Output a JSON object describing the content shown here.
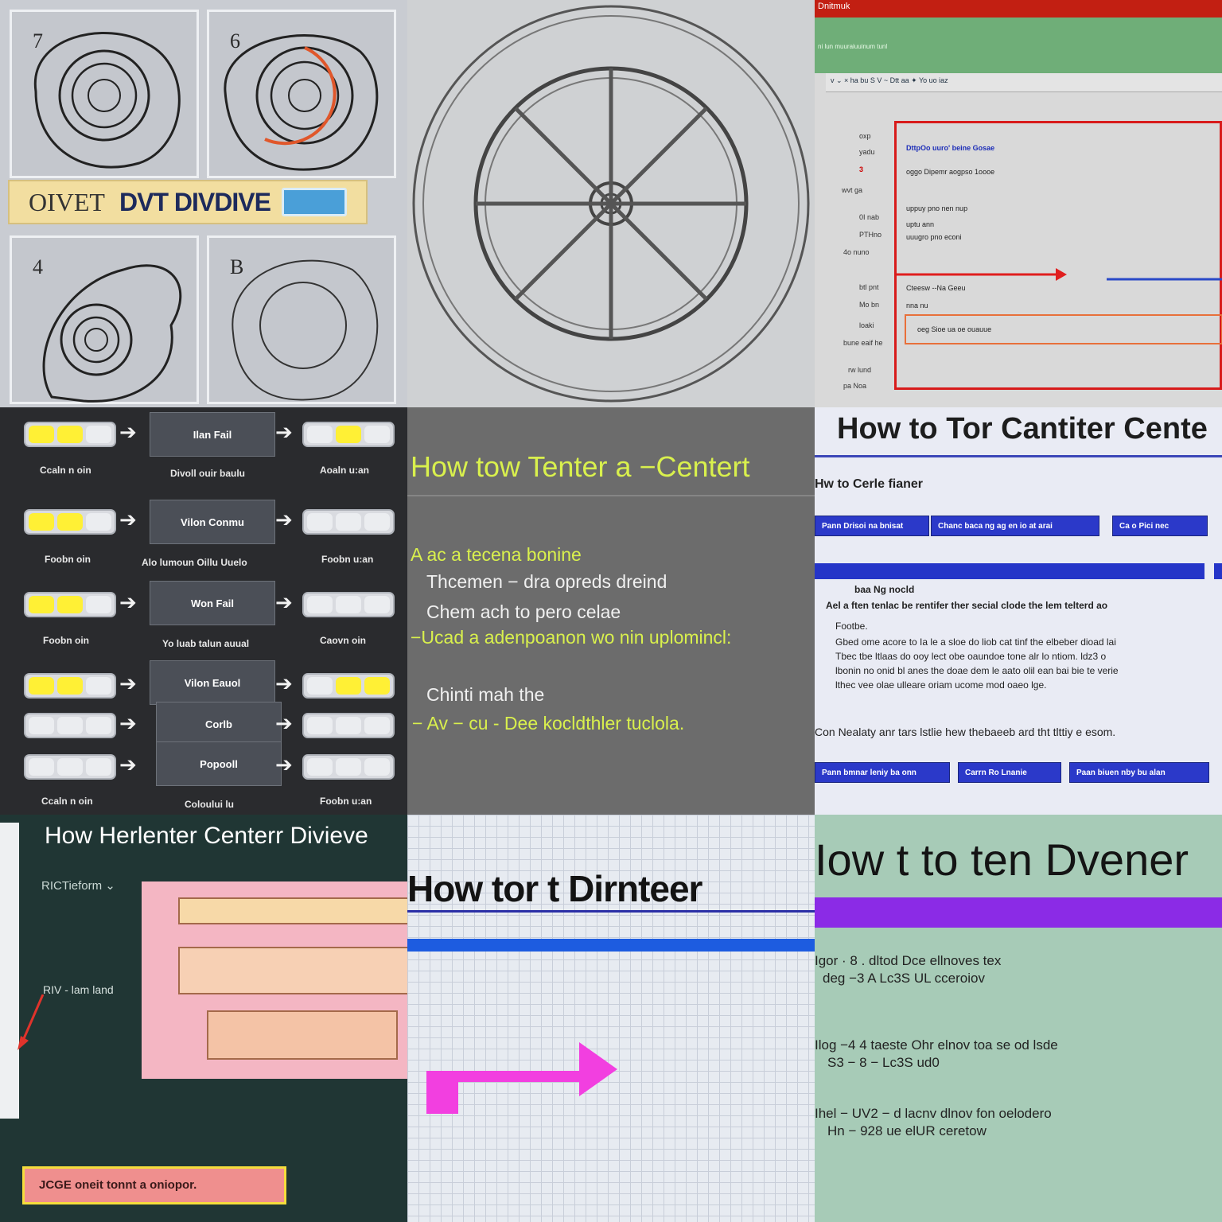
{
  "tile1": {
    "nums": [
      "7",
      "6",
      "4",
      "B"
    ],
    "banner_left": "OIVET",
    "banner_main": "DVT DIVDIVE",
    "colors": {
      "banner": "#f2dea0",
      "accent_ring": "#e0572b"
    }
  },
  "tile2": {
    "subject": "wheel-sketch"
  },
  "tile3": {
    "title": "Dnitmuk",
    "green_text": "ni lun muuraiuuinum tunl",
    "toolbar": "v  ⌄ ×  ha bu   S  V  ~  Dtt aa  ✦  Yo uo iaz",
    "side_labels": [
      "oxp",
      "yadu",
      "3",
      "wvt ga",
      "0I nab",
      "PTHno",
      "4o nuno",
      "btl pnt",
      "Mo bn",
      "loaki",
      "bune eaif he",
      "rw lund",
      "pa Noa"
    ],
    "rows": [
      "DttpOo  uuro' beine  Gosae",
      "oggo Dipemr  aogpso 1oooe",
      "uppuy pno nen nup",
      "uptu ann",
      "uuugro pno econi",
      "Cteesw  --Na     Geeu",
      "nna nu",
      "oeg Sioe ua oe ouauue"
    ],
    "colors": {
      "frame": "#d81b1b",
      "ribbon": "#6fae78"
    }
  },
  "tile4": {
    "rows": [
      {
        "left_label": "Ccaln n oin",
        "box": "Ilan Fail",
        "below": "Divoll ouir baulu",
        "right_label": "Aoaln u:an"
      },
      {
        "left_label": "Foobn oin",
        "box": "Vilon Conmu",
        "below": "Alo lumoun Oillu Uuelo",
        "right_label": "Foobn u:an"
      },
      {
        "left_label": "Foobn oin",
        "box": "Won Fail",
        "below": "Yo luab talun auual",
        "right_label": "Caovn oin"
      },
      {
        "left_label": "",
        "box": "Vilon Eauol",
        "below": "",
        "right_label": ""
      },
      {
        "left_label": "",
        "box": "Corlb",
        "below": "",
        "right_label": ""
      },
      {
        "left_label": "Ccaln n oin",
        "box": "Popooll",
        "below": "Coloului lu",
        "right_label": "Foobn u:an"
      }
    ]
  },
  "tile5": {
    "title": "How tow Tenter a −Centert",
    "lines": [
      "A ac a tecena bonine",
      "Thcemen − dra opreds dreind",
      "Chem ach to pero celae",
      "−Ucad a adenpoanon wo nin uplomincl:",
      "Chinti mah the",
      "− Av − cu - Dee kocldthler tuclola."
    ],
    "colors": {
      "accent": "#d9f04d"
    }
  },
  "tile6": {
    "title": "How to Tor Cantiter Cente",
    "subtitle": "Hw to Cerle fianer",
    "buttons_top": [
      "Pann Drisoi na bnisat",
      "Chanc baca ng ag en io at arai",
      "Ca   o  Pici  nec"
    ],
    "section_label": "baa Ng nocld",
    "para_lines": [
      "Ael a ften tenlac be rentifer ther secial clode the lem telterd ao",
      "Footbe.",
      "Gbed ome acore to Ia le a sloe do liob cat tinf the elbeber dioad lai",
      "Tbec tbe ltlaas do ooy lect obe oaundoe tone alr lo ntiom. ldz3 o",
      "lbonin no onid bl anes the doae dem le aato olil ean bai bie te verie",
      "lthec vee olae ulleare oriam ucome mod oaeo lge.",
      "Con Nealaty anr tars lstlie hew thebaeeb ard tht tlttiy e esom."
    ],
    "buttons_bottom": [
      "Pann bmnar leniy ba onn",
      "Carrn Ro Lnanie",
      "Paan biuen nby bu alan"
    ],
    "colors": {
      "button": "#2b39c9"
    }
  },
  "tile7": {
    "title": "How  Herlenter Centerr  Divieve",
    "dropdown": "RICTieform ⌄",
    "mid_label": "RIV - lam land",
    "warning": "JCGE oneit  tonnt a oniopor."
  },
  "tile8": {
    "title": "How tor t   Dirnteer",
    "colors": {
      "arrow": "#f23fe0",
      "bar": "#1d5ce0"
    }
  },
  "tile9": {
    "title": "Iow t to ten Dvener",
    "lines": [
      "Igor · 8 . dltod Dce ellnoves tex",
      "deg −3 A  Lc3S UL  cceroiov",
      "Ilog −4 4  taeste Ohr  elnov  toa  se  od lsde",
      "S3 − 8 − Lc3S ud0",
      "Ihel − UV2 − d lacnv  dlnov  fon  oelodero",
      "Hn − 928  ue elUR  ceretow"
    ],
    "colors": {
      "bar": "#8b2be6",
      "bg": "#a7cbb7"
    }
  }
}
